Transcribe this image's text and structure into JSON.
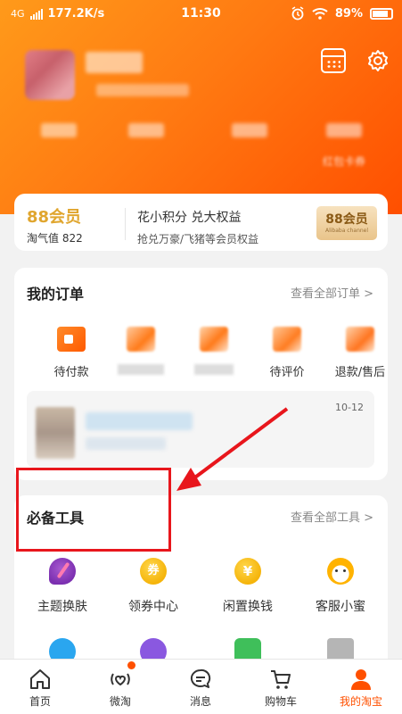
{
  "status_bar": {
    "network": "4G",
    "speed": "177.2K/s",
    "time": "11:30",
    "battery": "89%"
  },
  "header": {
    "stat_labels": [
      "",
      "",
      "",
      "红包卡券"
    ]
  },
  "vip": {
    "brand": "88会员",
    "score": "淘气值 822",
    "title": "花小积分 兑大权益",
    "subtitle": "抢兑万豪/飞猪等会员权益",
    "badge": "88会员",
    "badge_sub": "Alibaba channel"
  },
  "orders": {
    "title": "我的订单",
    "more": "查看全部订单 >",
    "items": [
      {
        "label": "待付款",
        "icon": "wallet-icon"
      },
      {
        "label": "",
        "icon": "package-icon"
      },
      {
        "label": "",
        "icon": "truck-icon"
      },
      {
        "label": "待评价",
        "icon": "review-icon"
      },
      {
        "label": "退款/售后",
        "icon": "refund-icon"
      }
    ],
    "logistics_date": "10-12"
  },
  "tools": {
    "title": "必备工具",
    "more": "查看全部工具 >",
    "items": [
      {
        "label": "主题换肤",
        "icon": "palette-icon"
      },
      {
        "label": "领券中心",
        "icon": "coupon-icon",
        "glyph": "券"
      },
      {
        "label": "闲置换钱",
        "icon": "yen-icon",
        "glyph": "¥"
      },
      {
        "label": "客服小蜜",
        "icon": "assistant-icon"
      }
    ]
  },
  "tabbar": [
    {
      "label": "首页",
      "icon": "home-icon"
    },
    {
      "label": "微淘",
      "icon": "weitao-icon"
    },
    {
      "label": "消息",
      "icon": "message-icon"
    },
    {
      "label": "购物车",
      "icon": "cart-icon"
    },
    {
      "label": "我的淘宝",
      "icon": "profile-icon",
      "active": true
    }
  ],
  "colors": {
    "brand_orange": "#ff5000",
    "gold": "#e0a62f",
    "annotation_red": "#e8161c"
  }
}
